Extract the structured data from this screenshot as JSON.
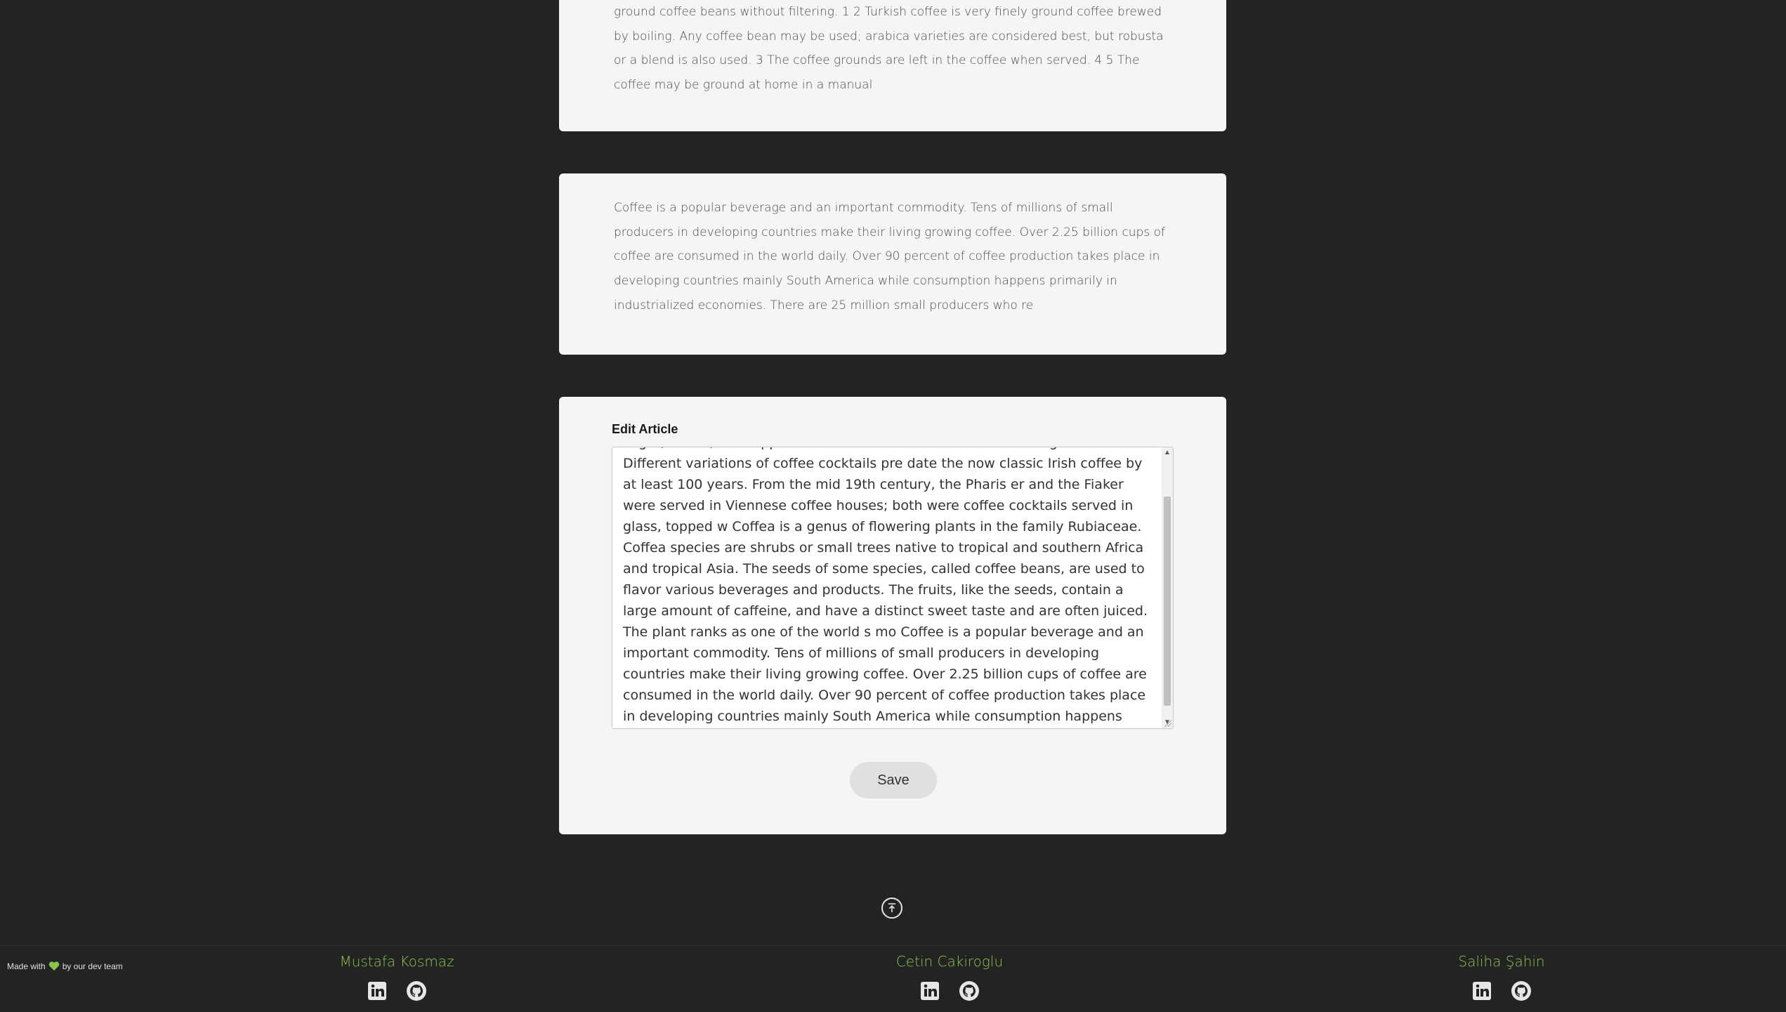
{
  "articles": [
    {
      "text": "ground coffee beans without filtering. 1 2 Turkish coffee is very finely ground coffee brewed by boiling. Any coffee bean may be used; arabica varieties are considered best, but robusta or a blend is also used. 3 The coffee grounds are left in the coffee when served. 4 5 The coffee may be ground at home in a manual"
    },
    {
      "text": "Coffee is a popular beverage and an important commodity. Tens of millions of small producers in developing countries make their living growing coffee. Over 2.25 billion cups of coffee are consumed in the world daily. Over 90 percent of coffee production takes place in developing countries mainly South America while consumption happens primarily in industrialized economies. There are 25 million small producers who re"
    }
  ],
  "edit": {
    "label": "Edit Article",
    "content": "sugar, sulfed, and topped with cream. The coffee is drunk through the cream. Different variations of coffee cocktails pre date the now classic Irish coffee by at least 100 years. From the mid 19th century, the Pharis er and the Fiaker were served in Viennese coffee houses; both were coffee cocktails served in glass, topped w Coffea is a genus of flowering plants in the family Rubiaceae. Coffea species are shrubs or small trees native to tropical and southern Africa and tropical Asia. The seeds of some species, called coffee beans, are used to flavor various beverages and products. The fruits, like the seeds, contain a large amount of caffeine, and have a distinct sweet taste and are often juiced. The plant ranks as one of the world s mo Coffee is a popular beverage and an important commodity. Tens of millions of small producers in developing countries make their living growing coffee. Over 2.25 billion cups of coffee are consumed in the world daily. Over 90 percent of coffee production takes place in developing countries mainly South America while consumption happens primarily in industrialized economies.EDIT",
    "save_label": "Save"
  },
  "footer": {
    "made_with_prefix": "Made with",
    "made_with_suffix": "by our dev team",
    "heart_color": "#8bc34a",
    "members": [
      {
        "name": "Mustafa Kosmaz",
        "icons": [
          "linkedin-icon",
          "github-icon"
        ]
      },
      {
        "name": "Cetin Cakiroglu",
        "icons": [
          "linkedin-icon",
          "github-icon"
        ]
      },
      {
        "name": "Saliha Şahin",
        "icons": [
          "linkedin-icon",
          "github-icon"
        ]
      }
    ]
  },
  "colors": {
    "background": "#232323",
    "card": "#f5f5f5",
    "accent": "#8bc34a"
  }
}
